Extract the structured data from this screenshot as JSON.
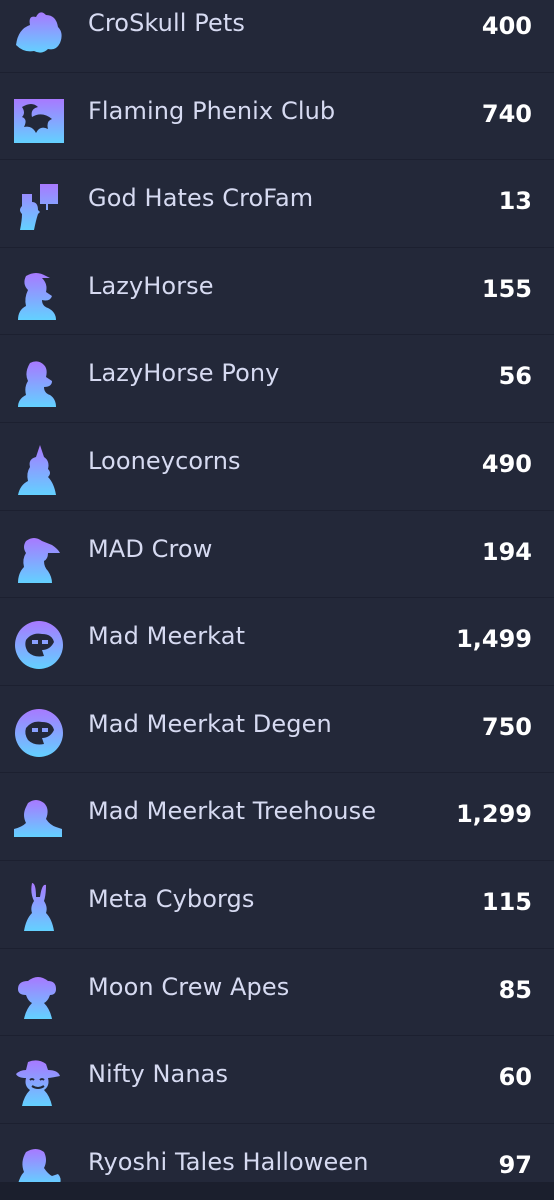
{
  "colors": {
    "background": "#232839",
    "row_divider": "#1c2030",
    "name_text": "#d6daf1",
    "count_text": "#ffffff",
    "icon_gradient_top": "#a879ff",
    "icon_gradient_bottom": "#63d1ff"
  },
  "collections": [
    {
      "name": "CroSkull Pets",
      "count": "400",
      "icon": "skull-pet-icon"
    },
    {
      "name": "Flaming Phenix Club",
      "count": "740",
      "icon": "phoenix-icon"
    },
    {
      "name": "God Hates CroFam",
      "count": "13",
      "icon": "protest-sign-icon"
    },
    {
      "name": "LazyHorse",
      "count": "155",
      "icon": "horse-icon"
    },
    {
      "name": "LazyHorse Pony",
      "count": "56",
      "icon": "pony-icon"
    },
    {
      "name": "Looneycorns",
      "count": "490",
      "icon": "unicorn-icon"
    },
    {
      "name": "MAD Crow",
      "count": "194",
      "icon": "crow-icon"
    },
    {
      "name": "Mad Meerkat",
      "count": "1,499",
      "icon": "meerkat-badge-icon"
    },
    {
      "name": "Mad Meerkat Degen",
      "count": "750",
      "icon": "meerkat-degen-badge-icon"
    },
    {
      "name": "Mad Meerkat Treehouse",
      "count": "1,299",
      "icon": "meerkat-treehouse-icon"
    },
    {
      "name": "Meta Cyborgs",
      "count": "115",
      "icon": "rabbit-cyborg-icon"
    },
    {
      "name": "Moon Crew Apes",
      "count": "85",
      "icon": "ape-icon"
    },
    {
      "name": "Nifty Nanas",
      "count": "60",
      "icon": "nana-icon"
    },
    {
      "name": "Ryoshi Tales Halloween",
      "count": "97",
      "icon": "ryoshi-halloween-icon"
    }
  ]
}
